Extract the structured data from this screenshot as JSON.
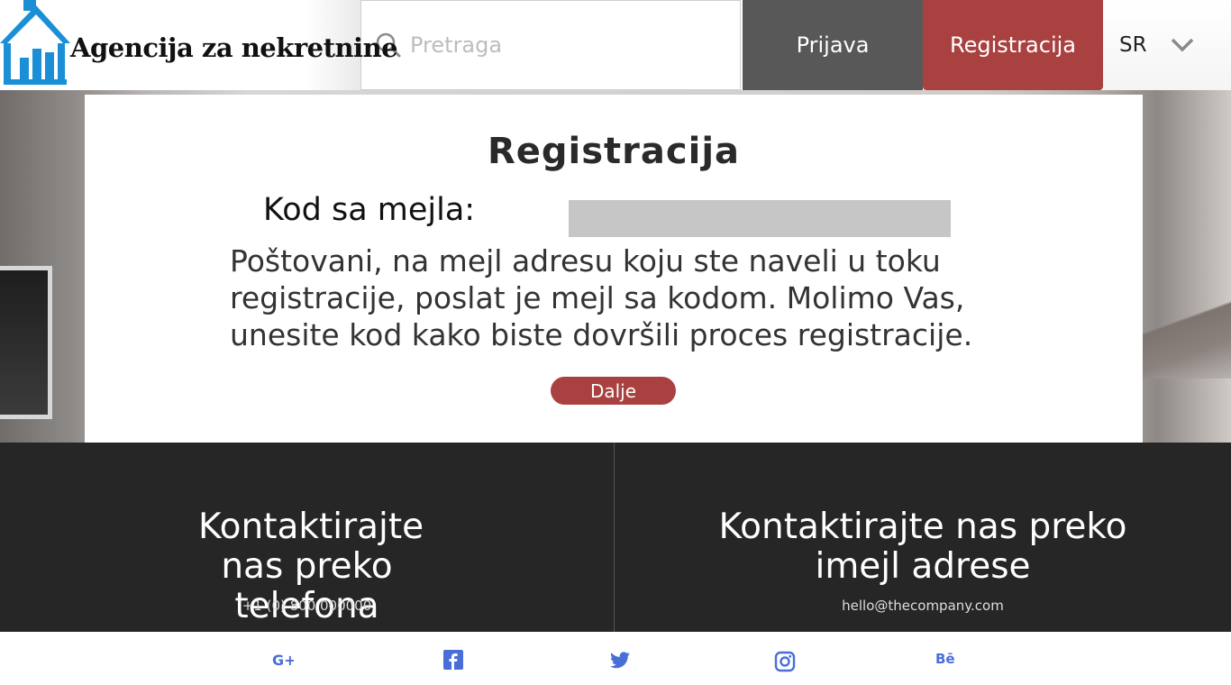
{
  "header": {
    "logo_text": "Agencija za nekretnine",
    "search_placeholder": "Pretraga",
    "login_label": "Prijava",
    "register_label": "Registracija",
    "language": "SR"
  },
  "card": {
    "title": "Registracija",
    "code_label": "Kod sa mejla:",
    "code_value": "",
    "message": "Poštovani, na mejl adresu koju ste naveli u toku registracije, poslat je mejl sa kodom. Molimo Vas, unesite kod kako biste dovršili proces registracije.",
    "next_label": "Dalje"
  },
  "contact": {
    "phone_title": "Kontaktirajte nas preko telefona",
    "phone_value": "+1 (0) 800 000000",
    "email_title": "Kontaktirajte nas preko imejl adrese",
    "email_value": "hello@thecompany.com"
  },
  "social": [
    "google-plus-icon",
    "facebook-icon",
    "twitter-icon",
    "instagram-icon",
    "behance-icon"
  ],
  "colors": {
    "accent": "#a8413f",
    "login_bg": "#585858",
    "footer_bg": "#262626",
    "social": "#4a6ed8",
    "logo_blue": "#1a8fd6"
  }
}
